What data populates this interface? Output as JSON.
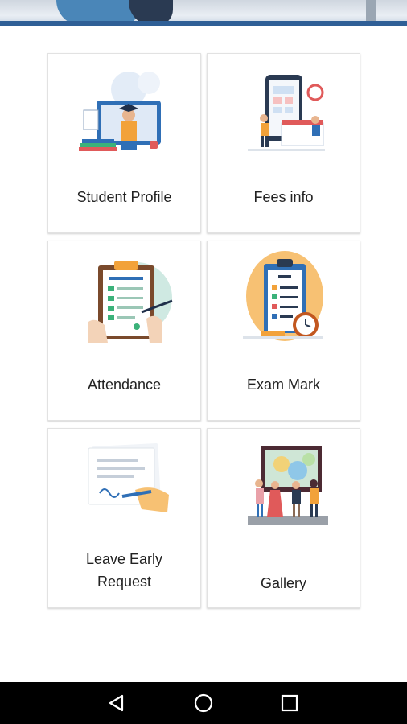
{
  "tiles": [
    {
      "label": "Student Profile",
      "icon": "student-profile-illustration"
    },
    {
      "label": "Fees info",
      "icon": "fees-info-illustration"
    },
    {
      "label": "Attendance",
      "icon": "attendance-clipboard-illustration"
    },
    {
      "label": "Exam Mark",
      "icon": "exam-test-clipboard-illustration"
    },
    {
      "label_line1": "Leave Early",
      "label_line2": "Request",
      "icon": "leave-request-document-illustration"
    },
    {
      "label": "Gallery",
      "icon": "gallery-people-illustration"
    }
  ],
  "navigation": {
    "back": "back-triangle-icon",
    "home": "home-circle-icon",
    "recents": "recents-square-icon"
  },
  "colors": {
    "accent_blue": "#2f6fb6",
    "orange": "#f2a23a",
    "green": "#3bb27a",
    "nav_bar": "#000000"
  }
}
